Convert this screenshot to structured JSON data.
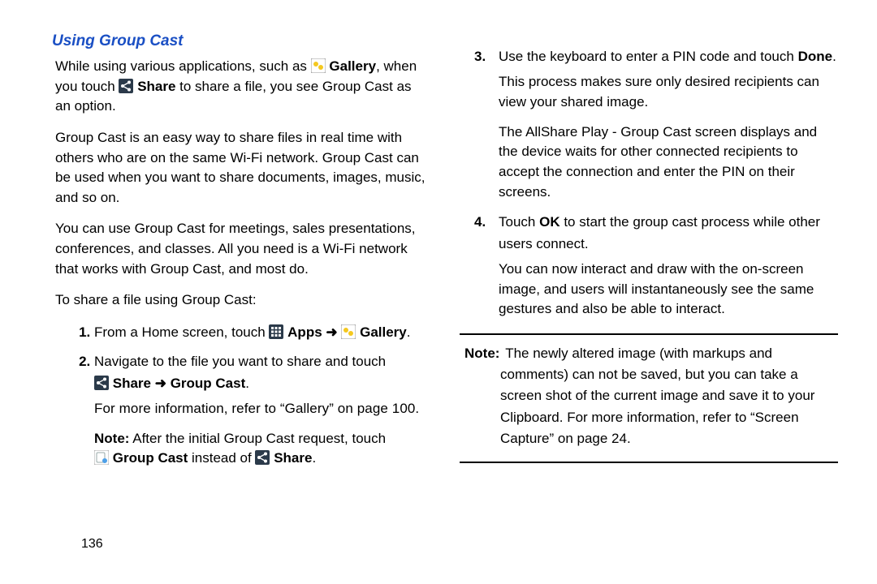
{
  "title": "Using Group Cast",
  "left": {
    "p1a": "While using various applications, such as ",
    "p1_gallery": "Gallery",
    "p1b": ", when you touch ",
    "p1_share": "Share",
    "p1c": " to share a file, you see Group Cast as an option.",
    "p2": "Group Cast is an easy way to share files in real time with others who are on the same Wi-Fi network. Group Cast can be used when you want to share documents, images, music, and so on.",
    "p3": "You can use Group Cast for meetings, sales presentations, conferences, and classes. All you need is a Wi-Fi network that works with Group Cast, and most do.",
    "p4": "To share a file using Group Cast:",
    "step1a": "From a Home screen, touch ",
    "step1_apps": "Apps",
    "step1_arrow": " ➜ ",
    "step1_gallery": "Gallery",
    "step1b": ".",
    "step2a": "Navigate to the file you want to share and touch ",
    "step2_share": "Share",
    "step2_arrow": " ➜ ",
    "step2_groupcast": "Group Cast",
    "step2b": ".",
    "step2_more": "For more information, refer to “Gallery” on page 100.",
    "note_label": "Note:",
    "note_a": " After the initial Group Cast request, touch ",
    "note_groupcast": "Group Cast",
    "note_b": " instead of ",
    "note_share": "Share",
    "note_c": "."
  },
  "right": {
    "step3a": "Use the keyboard to enter a PIN code and touch ",
    "step3_done": "Done",
    "step3b": ".",
    "step3_p1": "This process makes sure only desired recipients can view your shared image.",
    "step3_p2": "The AllShare Play - Group Cast screen displays and the device waits for other connected recipients to accept the connection and enter the PIN on their screens.",
    "step4a": "Touch ",
    "step4_ok": "OK",
    "step4b": " to start the group cast process while other users connect.",
    "step4_p1": "You can now interact and draw with the on-screen image, and users will instantaneously see the same gestures and also be able to interact.",
    "notebox_label": "Note:",
    "notebox_text": "The newly altered image (with markups and comments) can not be saved, but you can take a screen shot of the current image and save it to your Clipboard. For more information, refer to “Screen Capture” on page 24."
  },
  "page_number": "136"
}
